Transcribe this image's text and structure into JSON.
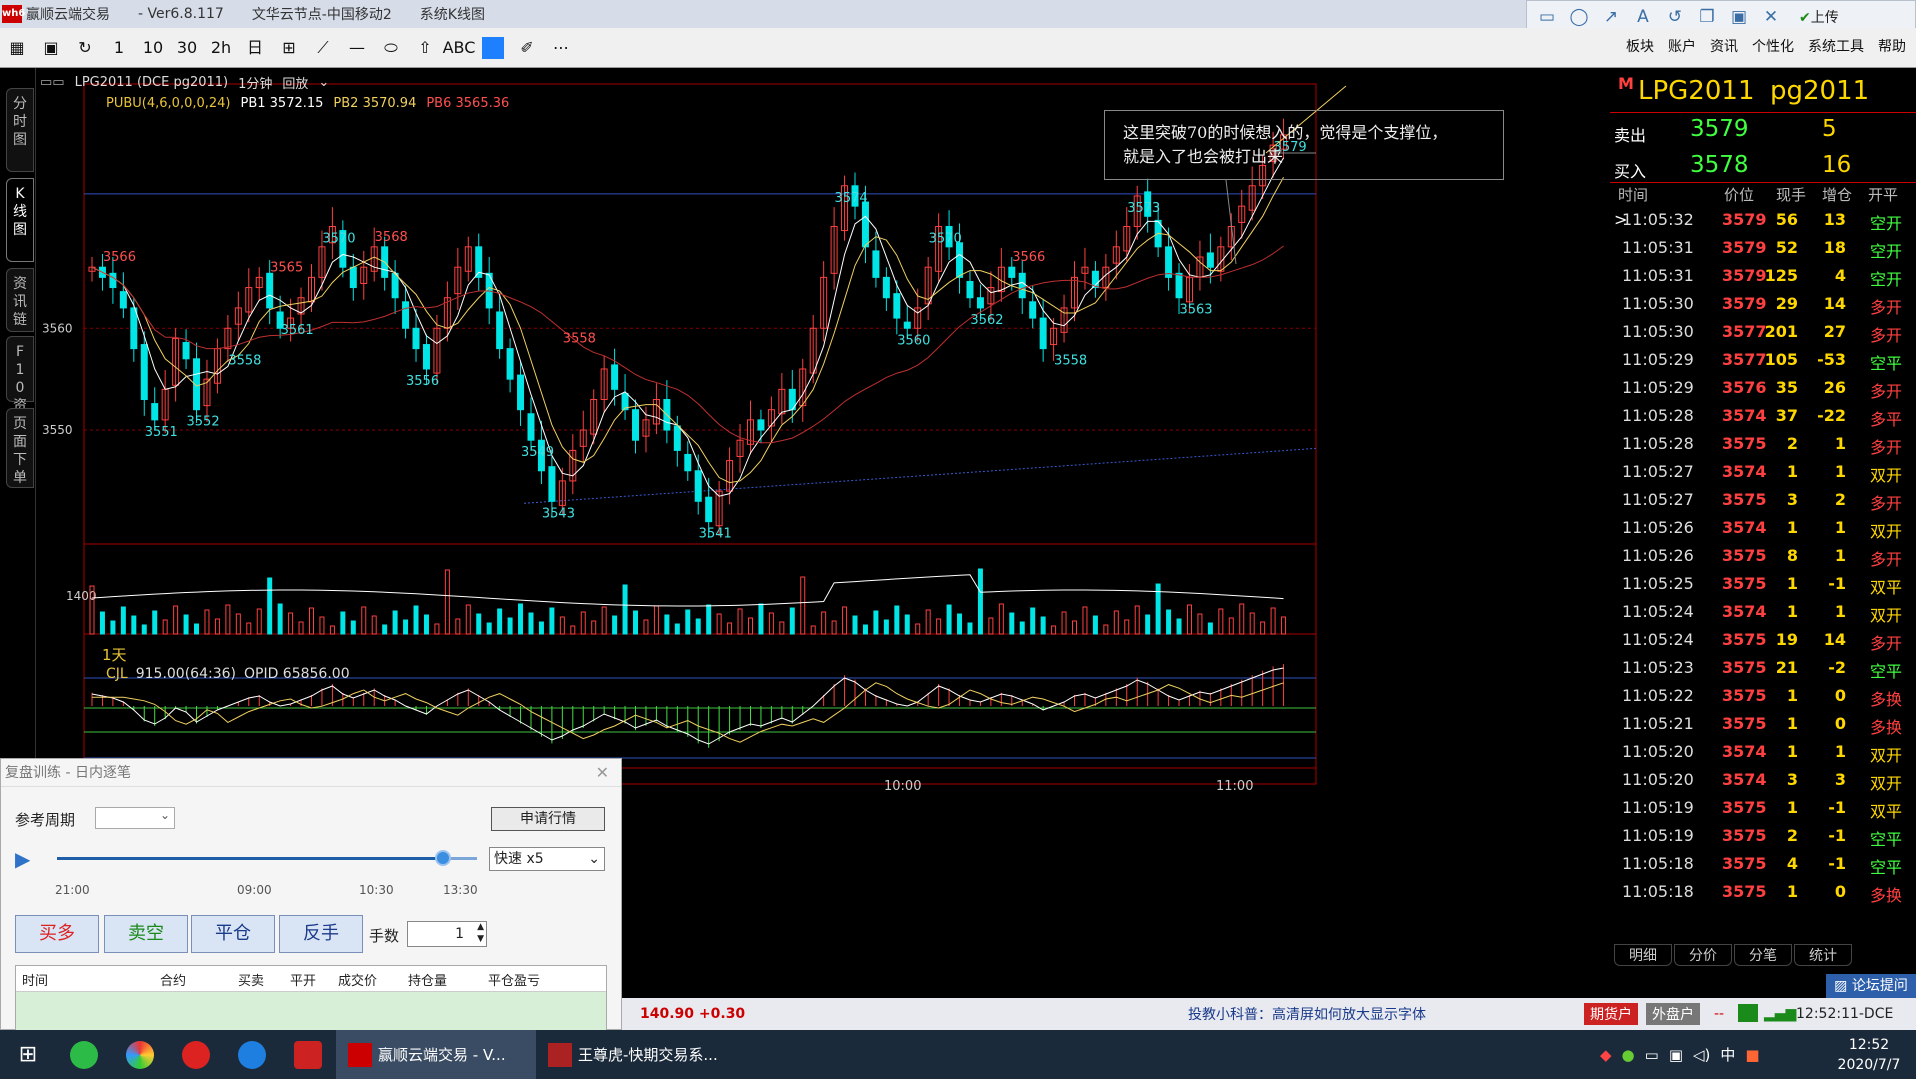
{
  "window": {
    "logo_text": "wh6",
    "app_name": "赢顺云端交易",
    "version": "- Ver6.8.117",
    "node": "文华云节点-中国移动2",
    "view": "系统K线图"
  },
  "top_icons": [
    "rectangle-icon",
    "ellipse-icon",
    "arrow-icon",
    "text-icon",
    "undo-icon",
    "copy-icon",
    "save-icon",
    "close-icon"
  ],
  "top_icon_glyphs": [
    "▭",
    "◯",
    "↗",
    "A",
    "↺",
    "❐",
    "▣",
    "✕"
  ],
  "upload_label": "上传",
  "toolbar_glyphs": [
    "▦",
    "▣",
    "↻",
    "1",
    "10",
    "30",
    "2h",
    "日",
    "⊞",
    "⟋",
    "—",
    "⬭",
    "⇧",
    "ABC",
    "",
    "✐",
    "⋯"
  ],
  "menus": [
    "板块",
    "账户",
    "资讯",
    "个性化",
    "系统工具",
    "帮助"
  ],
  "side_tabs": [
    {
      "label": "分时图",
      "active": false
    },
    {
      "label": "K线图",
      "active": true
    },
    {
      "label": "资讯链",
      "active": false
    },
    {
      "label": "F10资料",
      "active": false
    },
    {
      "label": "页面下单",
      "active": false
    }
  ],
  "chart_header": {
    "symbol": "LPG2011 (DCE pg2011)",
    "period": "1分钟",
    "mode": "回放"
  },
  "indicator_line": {
    "name": "PUBU(4,6,0,0,0,24)",
    "pb1": "PB1 3572.15",
    "pb2": "PB2 3570.94",
    "pb6": "PB6 3565.36"
  },
  "annotation": "这里突破70的时候想入的，觉得是个支撑位，\n就是入了也会被打出来",
  "period_label": "1天",
  "volume_header": {
    "name": "CJL",
    "value": "915.00(64:36)",
    "opid": "OPID 65856.00"
  },
  "chart_data": {
    "type": "candlestick",
    "title": "LPG2011 (DCE pg2011) 1分钟",
    "yaxis_ticks": [
      3550,
      3560
    ],
    "ylim": [
      3539,
      3584
    ],
    "price_labels": [
      {
        "text": "3551",
        "value": 3551
      },
      {
        "text": "3552",
        "value": 3552
      },
      {
        "text": "3566",
        "value": 3566
      },
      {
        "text": "3558",
        "value": 3558
      },
      {
        "text": "3565",
        "value": 3565
      },
      {
        "text": "3561",
        "value": 3561
      },
      {
        "text": "3570",
        "value": 3570
      },
      {
        "text": "3556",
        "value": 3556
      },
      {
        "text": "3568",
        "value": 3568
      },
      {
        "text": "3543",
        "value": 3543
      },
      {
        "text": "3549",
        "value": 3549
      },
      {
        "text": "3558",
        "value": 3558
      },
      {
        "text": "3541",
        "value": 3541
      },
      {
        "text": "3574",
        "value": 3574
      },
      {
        "text": "3560",
        "value": 3560
      },
      {
        "text": "3570",
        "value": 3570
      },
      {
        "text": "3562",
        "value": 3562
      },
      {
        "text": "3566",
        "value": 3566
      },
      {
        "text": "3558",
        "value": 3558
      },
      {
        "text": "3573",
        "value": 3573
      },
      {
        "text": "3563",
        "value": 3563
      },
      {
        "text": "3579",
        "value": 3579
      }
    ],
    "volume_ticks": [
      1400
    ],
    "time_ticks": [
      "10:00",
      "11:00"
    ],
    "close_series": [
      3566,
      3565,
      3564,
      3562,
      3558,
      3553,
      3551,
      3554,
      3559,
      3557,
      3552,
      3555,
      3558,
      3560,
      3562,
      3564,
      3565,
      3562,
      3560,
      3561,
      3563,
      3565,
      3568,
      3570,
      3566,
      3564,
      3566,
      3568,
      3565,
      3563,
      3560,
      3558,
      3556,
      3560,
      3563,
      3566,
      3568,
      3565,
      3562,
      3558,
      3555,
      3552,
      3549,
      3546,
      3543,
      3545,
      3548,
      3550,
      3553,
      3556,
      3554,
      3552,
      3549,
      3551,
      3553,
      3550,
      3548,
      3546,
      3543,
      3541,
      3544,
      3547,
      3549,
      3551,
      3550,
      3552,
      3554,
      3552,
      3556,
      3560,
      3565,
      3570,
      3574,
      3572,
      3568,
      3565,
      3563,
      3561,
      3560,
      3562,
      3566,
      3570,
      3568,
      3565,
      3563,
      3562,
      3564,
      3566,
      3565,
      3563,
      3561,
      3558,
      3560,
      3562,
      3565,
      3566,
      3564,
      3566,
      3568,
      3570,
      3573,
      3571,
      3568,
      3565,
      3563,
      3565,
      3567,
      3566,
      3568,
      3570,
      3572,
      3574,
      3576,
      3578,
      3579
    ]
  },
  "right_panel": {
    "flag": "M",
    "symbol": "LPG2011",
    "code": "pg2011",
    "sell_label": "卖出",
    "sell_price": "3579",
    "sell_qty": "5",
    "buy_label": "买入",
    "buy_price": "3578",
    "buy_qty": "16",
    "headers": [
      "时间",
      "价位",
      "现手",
      "增仓",
      "开平"
    ],
    "trades": [
      [
        "11:05:32",
        "3579",
        "56",
        "13",
        "空开"
      ],
      [
        "11:05:31",
        "3579",
        "52",
        "18",
        "空开"
      ],
      [
        "11:05:31",
        "3579",
        "125",
        "4",
        "空开"
      ],
      [
        "11:05:30",
        "3579",
        "29",
        "14",
        "多开"
      ],
      [
        "11:05:30",
        "3577",
        "201",
        "27",
        "多开"
      ],
      [
        "11:05:29",
        "3577",
        "105",
        "-53",
        "空平"
      ],
      [
        "11:05:29",
        "3576",
        "35",
        "26",
        "多开"
      ],
      [
        "11:05:28",
        "3574",
        "37",
        "-22",
        "多平"
      ],
      [
        "11:05:28",
        "3575",
        "2",
        "1",
        "多开"
      ],
      [
        "11:05:27",
        "3574",
        "1",
        "1",
        "双开"
      ],
      [
        "11:05:27",
        "3575",
        "3",
        "2",
        "多开"
      ],
      [
        "11:05:26",
        "3574",
        "1",
        "1",
        "双开"
      ],
      [
        "11:05:26",
        "3575",
        "8",
        "1",
        "多开"
      ],
      [
        "11:05:25",
        "3575",
        "1",
        "-1",
        "双平"
      ],
      [
        "11:05:24",
        "3574",
        "1",
        "1",
        "双开"
      ],
      [
        "11:05:24",
        "3575",
        "19",
        "14",
        "多开"
      ],
      [
        "11:05:23",
        "3575",
        "21",
        "-2",
        "空平"
      ],
      [
        "11:05:22",
        "3575",
        "1",
        "0",
        "多换"
      ],
      [
        "11:05:21",
        "3575",
        "1",
        "0",
        "多换"
      ],
      [
        "11:05:20",
        "3574",
        "1",
        "1",
        "双开"
      ],
      [
        "11:05:20",
        "3574",
        "3",
        "3",
        "双开"
      ],
      [
        "11:05:19",
        "3575",
        "1",
        "-1",
        "双平"
      ],
      [
        "11:05:19",
        "3575",
        "2",
        "-1",
        "空平"
      ],
      [
        "11:05:18",
        "3575",
        "4",
        "-1",
        "空平"
      ],
      [
        "11:05:18",
        "3575",
        "1",
        "0",
        "多换"
      ]
    ],
    "bottom_tabs": [
      "明细",
      "分价",
      "分笔",
      "统计"
    ]
  },
  "forum_button": "论坛提问",
  "replay": {
    "title": "复盘训练 - 日内逐笔",
    "period_label": "参考周期",
    "request_button": "申请行情",
    "time_marks": [
      "21:00",
      "09:00",
      "10:30",
      "13:30"
    ],
    "speed": "快速 x5",
    "buttons": {
      "buy_long": "买多",
      "sell_short": "卖空",
      "close": "平仓",
      "reverse": "反手"
    },
    "qty_label": "手数",
    "qty_value": "1",
    "table_headers": [
      "时间",
      "合约",
      "买卖",
      "平开",
      "成交价",
      "持仓量",
      "平仓盈亏"
    ],
    "progress": 0.92
  },
  "status": {
    "values": "140.90 +0.30",
    "tip": "投教小科普：高清屏如何放大显示字体",
    "futures_account": "期货户",
    "external_account": "外盘户",
    "dash": "--",
    "clock": "12:52:11-DCE"
  },
  "taskbar": {
    "apps": [
      {
        "label": "赢顺云端交易 - V...",
        "active": true
      },
      {
        "label": "王尊虎-快期交易系...",
        "active": false
      }
    ],
    "ime": "中",
    "time": "12:52",
    "date": "2020/7/7"
  }
}
